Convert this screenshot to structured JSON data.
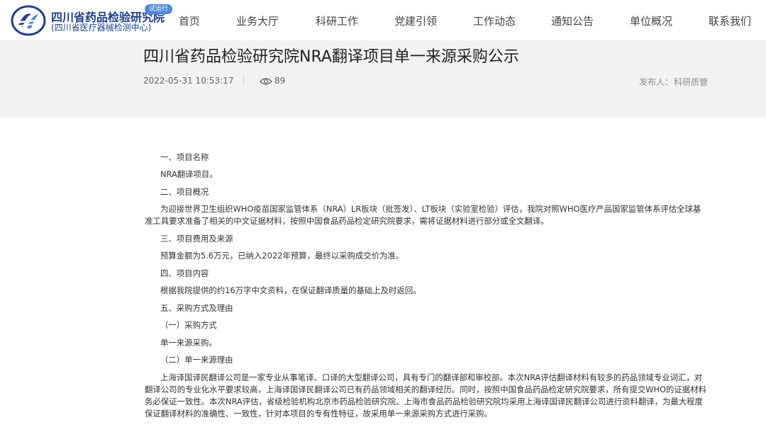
{
  "header": {
    "org_name": "四川省药品检验研究院",
    "org_sub": "(四川省医疗器械检测中心)",
    "badge": "试运行",
    "logo_icon": "institute-logo-icon",
    "brand_color": "#1f3f8a"
  },
  "nav": {
    "items": [
      {
        "label": "首页"
      },
      {
        "label": "业务大厅"
      },
      {
        "label": "科研工作"
      },
      {
        "label": "党建引领"
      },
      {
        "label": "工作动态"
      },
      {
        "label": "通知公告"
      },
      {
        "label": "单位概况"
      },
      {
        "label": "联系我们"
      }
    ]
  },
  "article": {
    "title": "四川省药品检验研究院NRA翻译项目单一来源采购公示",
    "date": "2022-05-31 10:53:17",
    "views": "89",
    "views_icon": "eye-icon",
    "publisher_label": "发布人：",
    "publisher": "科研质管",
    "lines": [
      "一、项目名称",
      "NRA翻译项目。",
      "二、项目概况",
      "为迎接世界卫生组织WHO疫苗国家监管体系（NRA）LR板块（批签发）、LT板块（实验室检验）评估，我院对照WHO医疗产品国家监管体系评估全球基准工具要求准备了相关的中文证据材料，按照中国食品药品检定研究院要求，需将证据材料进行部分或全文翻译。",
      "三、项目费用及来源",
      "预算金额为5.6万元，已纳入2022年预算，最终以采购成交价为准。",
      "四、项目内容",
      "根据我院提供的约16万字中文资料，在保证翻译质量的基础上及时返回。",
      "五、采购方式及理由",
      "（一）采购方式",
      "单一来源采购。",
      "（二）单一来源理由",
      "上海译国译民翻译公司是一家专业从事笔译、口译的大型翻译公司，具有专门的翻译部和审校部。本次NRA评估翻译材料有较多的药品领域专业词汇，对翻译公司的专业化水平要求较高，上海译国译民翻译公司已有药品领域相关的翻译经历。同时，按照中国食品药品检定研究院要求，所有提交WHO的证据材料务必保证一致性。本次NRA评估，省级检验机构北京市药品检验研究院、上海市食品药品检验研究院均采用上海译国译民翻译公司进行资料翻译，为最大程度保证翻译材料的准确性、一致性，针对本项目的专有性特征，故采用单一来源采购方式进行采购。"
    ]
  }
}
